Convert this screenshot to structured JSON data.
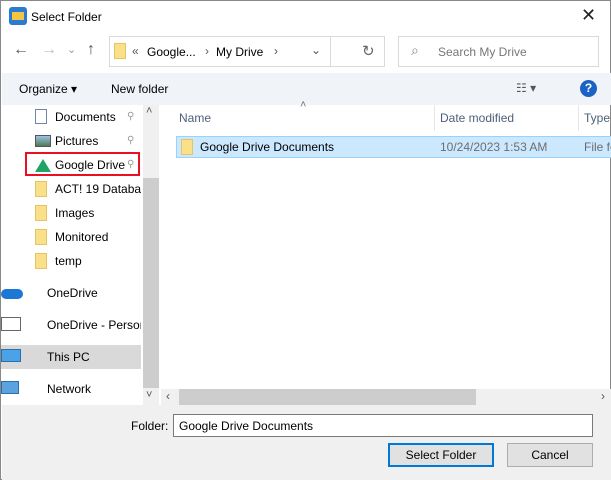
{
  "window": {
    "title": "Select Folder",
    "close": "✕"
  },
  "nav": {
    "back": "←",
    "forward": "→",
    "recent": "⌄",
    "up": "↑",
    "refresh": "↻"
  },
  "address": {
    "overflow": "«",
    "crumbs": [
      "Google...",
      "My Drive"
    ],
    "sep": "›",
    "dropdown": "⌄"
  },
  "search": {
    "placeholder": "Search My Drive",
    "icon": "⌕"
  },
  "toolbar": {
    "organize": "Organize ▾",
    "new_folder": "New folder",
    "view": "☷ ▾",
    "help": "?"
  },
  "sidebar": {
    "items": [
      {
        "label": "Documents",
        "icon": "documents-icon",
        "pinned": true
      },
      {
        "label": "Pictures",
        "icon": "pictures-icon",
        "pinned": true
      },
      {
        "label": "Google Drive",
        "icon": "google-drive-icon",
        "pinned": true,
        "highlighted": true
      },
      {
        "label": "ACT! 19 Databas",
        "icon": "folder-icon"
      },
      {
        "label": "Images",
        "icon": "folder-icon"
      },
      {
        "label": "Monitored",
        "icon": "folder-icon"
      },
      {
        "label": "temp",
        "icon": "folder-icon"
      },
      {
        "label": "OneDrive",
        "icon": "onedrive-icon"
      },
      {
        "label": "OneDrive - Persor",
        "icon": "onedrive-personal-icon"
      },
      {
        "label": "This PC",
        "icon": "this-pc-icon",
        "selected": true
      },
      {
        "label": "Network",
        "icon": "network-icon"
      }
    ],
    "pin": "📌"
  },
  "columns": [
    "Name",
    "Date modified",
    "Type"
  ],
  "files": [
    {
      "name": "Google Drive Documents",
      "date": "10/24/2023 1:53 AM",
      "type": "File fo"
    }
  ],
  "footer": {
    "folder_label": "Folder:",
    "folder_value": "Google Drive Documents",
    "select": "Select Folder",
    "cancel": "Cancel"
  },
  "colors": {
    "selection": "#cce8ff",
    "highlight_box": "#e81123",
    "accent": "#0078d7"
  }
}
